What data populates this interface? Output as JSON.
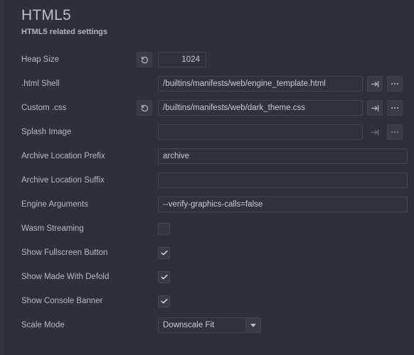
{
  "header": {
    "title": "HTML5",
    "subtitle": "HTML5 related settings"
  },
  "icons": {
    "reset": "reset-icon",
    "goto": "goto-icon",
    "browse": "ellipsis-icon",
    "dropdown": "chevron-down-icon",
    "check": "check-icon"
  },
  "rows": {
    "heap_size": {
      "label": "Heap Size",
      "value": "1024"
    },
    "html_shell": {
      "label": ".html Shell",
      "value": "/builtins/manifests/web/engine_template.html"
    },
    "custom_css": {
      "label": "Custom .css",
      "value": "/builtins/manifests/web/dark_theme.css"
    },
    "splash_image": {
      "label": "Splash Image",
      "value": ""
    },
    "archive_prefix": {
      "label": "Archive Location Prefix",
      "value": "archive"
    },
    "archive_suffix": {
      "label": "Archive Location Suffix",
      "value": ""
    },
    "engine_arguments": {
      "label": "Engine Arguments",
      "value": "--verify-graphics-calls=false"
    },
    "wasm_streaming": {
      "label": "Wasm Streaming",
      "checked": false
    },
    "show_fullscreen_button": {
      "label": "Show Fullscreen Button",
      "checked": true
    },
    "show_made_with_defold": {
      "label": "Show Made With Defold",
      "checked": true
    },
    "show_console_banner": {
      "label": "Show Console Banner",
      "checked": true
    },
    "scale_mode": {
      "label": "Scale Mode",
      "value": "Downscale Fit"
    }
  }
}
